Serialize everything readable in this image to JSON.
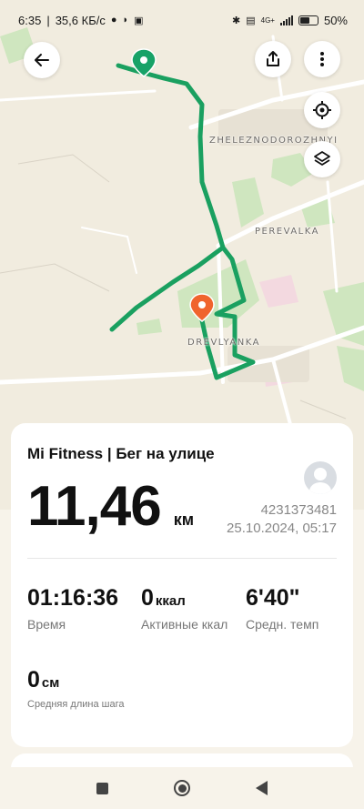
{
  "status_bar": {
    "time": "6:35",
    "speed": "35,6 КБ/с",
    "network": "4G+",
    "battery": "50%"
  },
  "map": {
    "labels": {
      "zheleznodorozhnyi": "ZHELEZNODOROZHNYI",
      "perevalka": "PEREVALKA",
      "drevlyanka": "DREVLYANKA"
    },
    "route_color": "#1aa060",
    "start_pin_color": "#17a267",
    "end_pin_color": "#f0642d"
  },
  "workout": {
    "title": "Mi Fitness | Бег на улице",
    "distance": "11,46",
    "distance_unit": "км",
    "id": "4231373481",
    "datetime": "25.10.2024, 05:17",
    "stats": [
      {
        "value": "01:16:36",
        "unit": "",
        "label": "Время"
      },
      {
        "value": "0",
        "unit": "ккал",
        "label": "Активные ккал"
      },
      {
        "value": "6'40\"",
        "unit": "",
        "label": "Средн. темп"
      },
      {
        "value": "0",
        "unit": "см",
        "label": "Средняя длина шага"
      }
    ]
  },
  "icons": {
    "back": "arrow-left-icon",
    "share": "share-icon",
    "more": "more-vertical-icon",
    "locate": "locate-icon",
    "layers": "layers-icon"
  }
}
